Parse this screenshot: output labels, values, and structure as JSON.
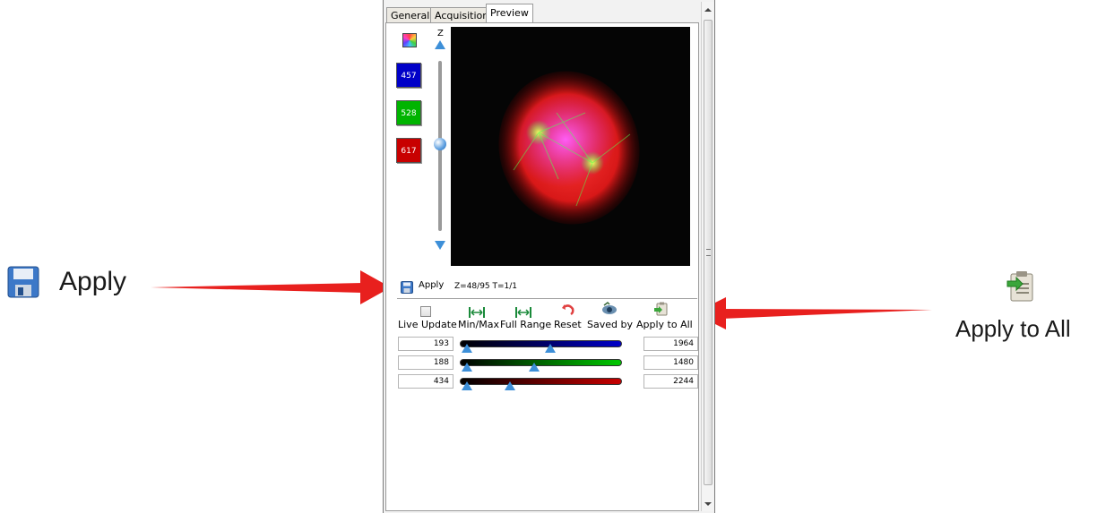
{
  "callouts": {
    "apply_label": "Apply",
    "apply_all_label": "Apply to All"
  },
  "tabs": [
    {
      "label": "General"
    },
    {
      "label": "Acquisition"
    },
    {
      "label": "Preview"
    }
  ],
  "z_axis_label": "Z",
  "channels": [
    {
      "label": "457",
      "color": "#0000c8"
    },
    {
      "label": "528",
      "color": "#00b400"
    },
    {
      "label": "617",
      "color": "#c80000"
    }
  ],
  "preview": {
    "apply_label": "Apply",
    "position_text": "Z=48/95 T=1/1",
    "z_slider_fraction": 0.48
  },
  "toolbar": {
    "live_update": "Live Update",
    "min_max": "Min/Max",
    "full_range": "Full Range",
    "reset": "Reset",
    "saved_by": "Saved by",
    "apply_to_all": "Apply to All"
  },
  "ranges": [
    {
      "min": "193",
      "max": "1964",
      "color": "#0000c8"
    },
    {
      "min": "188",
      "max": "1480",
      "color": "#00c800"
    },
    {
      "min": "434",
      "max": "2244",
      "color": "#c80000"
    }
  ],
  "colors": {
    "arrow": "#e8201e",
    "slider_thumb": "#3d8fd8"
  }
}
